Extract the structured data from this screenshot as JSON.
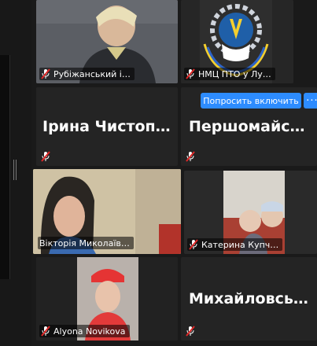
{
  "tiles": [
    {
      "name": "Рубіжанський і…"
    },
    {
      "name": "НМЦ ПТО у Лу…"
    },
    {
      "name": "Ірина  Чистопа…"
    },
    {
      "name": "Першомайськи…"
    },
    {
      "name": "Вікторія Миколаїв…"
    },
    {
      "name": "Катерина Купч…"
    },
    {
      "name": "Alyona Novikova"
    },
    {
      "name": "Михайловська…"
    }
  ],
  "controls": {
    "ask_unmute_label": "Попросить включить",
    "more_label": "···"
  },
  "colors": {
    "active_speaker_border": "#a8d44a",
    "button_blue": "#2d8cff",
    "mic_muted_red": "#e02828"
  }
}
